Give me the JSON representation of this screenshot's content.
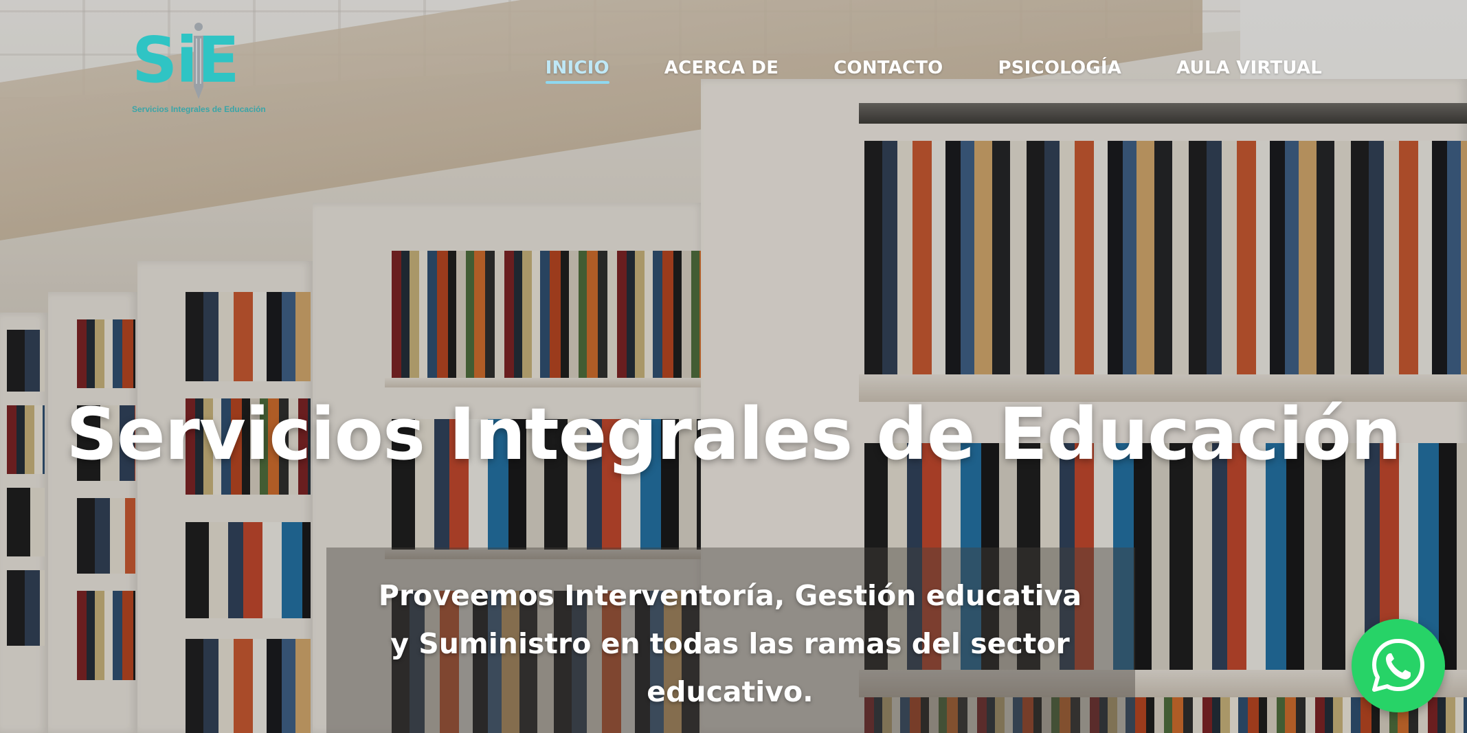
{
  "brand": {
    "logo_letters": "SiE",
    "tagline": "Servicios Integrales de Educación",
    "logo_color": "#2fc4c4"
  },
  "nav": {
    "items": [
      {
        "label": "INICIO",
        "active": true
      },
      {
        "label": "ACERCA DE",
        "active": false
      },
      {
        "label": "CONTACTO",
        "active": false
      },
      {
        "label": "PSICOLOGÍA",
        "active": false
      },
      {
        "label": "AULA VIRTUAL",
        "active": false
      }
    ],
    "active_color": "#8ed8f0"
  },
  "hero": {
    "title": "Servicios Integrales de Educación",
    "subtitle": "Proveemos Interventoría, Gestión educativa y Suministro en todas las ramas del sector educativo."
  },
  "whatsapp": {
    "icon": "whatsapp-icon",
    "color": "#27d367"
  },
  "background": {
    "image_subject": "library-bookshelves"
  }
}
